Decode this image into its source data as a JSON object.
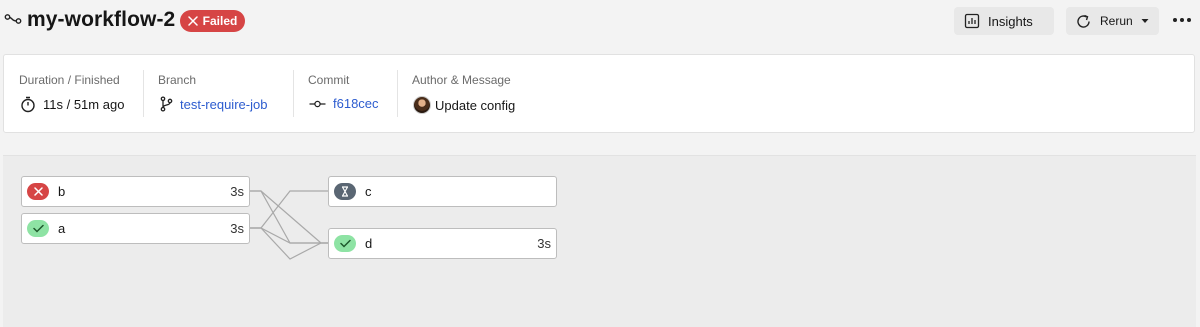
{
  "header": {
    "title": "my-workflow-2",
    "status": "Failed",
    "insights_label": "Insights",
    "rerun_label": "Rerun"
  },
  "info": {
    "duration_label": "Duration / Finished",
    "duration_value": "11s / 51m ago",
    "branch_label": "Branch",
    "branch_value": "test-require-job",
    "commit_label": "Commit",
    "commit_value": "f618cec",
    "author_label": "Author & Message",
    "author_message": "Update config"
  },
  "jobs": {
    "b": {
      "name": "b",
      "duration": "3s",
      "status": "failed"
    },
    "a": {
      "name": "a",
      "duration": "3s",
      "status": "success"
    },
    "c": {
      "name": "c",
      "duration": "",
      "status": "waiting"
    },
    "d": {
      "name": "d",
      "duration": "3s",
      "status": "success"
    }
  },
  "colors": {
    "failed": "#d64545",
    "success": "#8ee3a4",
    "waiting": "#5a6673",
    "link": "#2d5ccf"
  }
}
